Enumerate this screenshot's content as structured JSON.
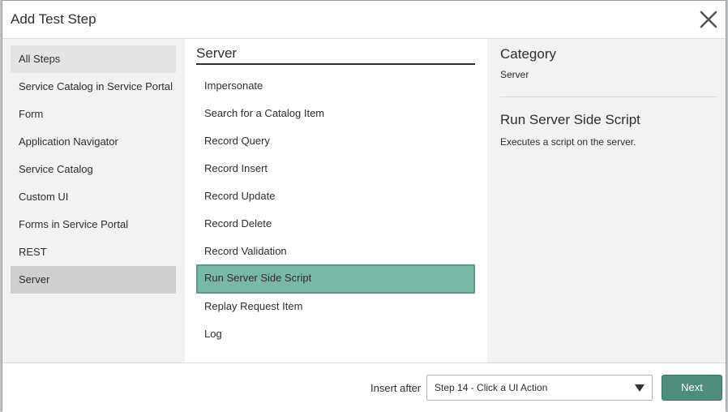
{
  "dialog": {
    "title": "Add Test Step",
    "close_icon": "close-icon"
  },
  "categories": [
    {
      "label": "All Steps",
      "state": "hover"
    },
    {
      "label": "Service Catalog in Service Portal",
      "state": ""
    },
    {
      "label": "Form",
      "state": ""
    },
    {
      "label": "Application Navigator",
      "state": ""
    },
    {
      "label": "Service Catalog",
      "state": ""
    },
    {
      "label": "Custom UI",
      "state": ""
    },
    {
      "label": "Forms in Service Portal",
      "state": ""
    },
    {
      "label": "REST",
      "state": ""
    },
    {
      "label": "Server",
      "state": "selected"
    }
  ],
  "steps": {
    "heading": "Server",
    "items": [
      {
        "label": "Impersonate",
        "selected": false
      },
      {
        "label": "Search for a Catalog Item",
        "selected": false
      },
      {
        "label": "Record Query",
        "selected": false
      },
      {
        "label": "Record Insert",
        "selected": false
      },
      {
        "label": "Record Update",
        "selected": false
      },
      {
        "label": "Record Delete",
        "selected": false
      },
      {
        "label": "Record Validation",
        "selected": false
      },
      {
        "label": "Run Server Side Script",
        "selected": true
      },
      {
        "label": "Replay Request Item",
        "selected": false
      },
      {
        "label": "Log",
        "selected": false
      }
    ]
  },
  "details": {
    "category_label": "Category",
    "category_value": "Server",
    "step_title": "Run Server Side Script",
    "step_description": "Executes a script on the server."
  },
  "footer": {
    "insert_after_label": "Insert after",
    "insert_after_value": "Step 14 - Click a UI Action",
    "next_label": "Next"
  },
  "colors": {
    "selected_step": "#79b8a6",
    "primary_button": "#4e8c7d",
    "panel_background": "#f2f2f2"
  }
}
